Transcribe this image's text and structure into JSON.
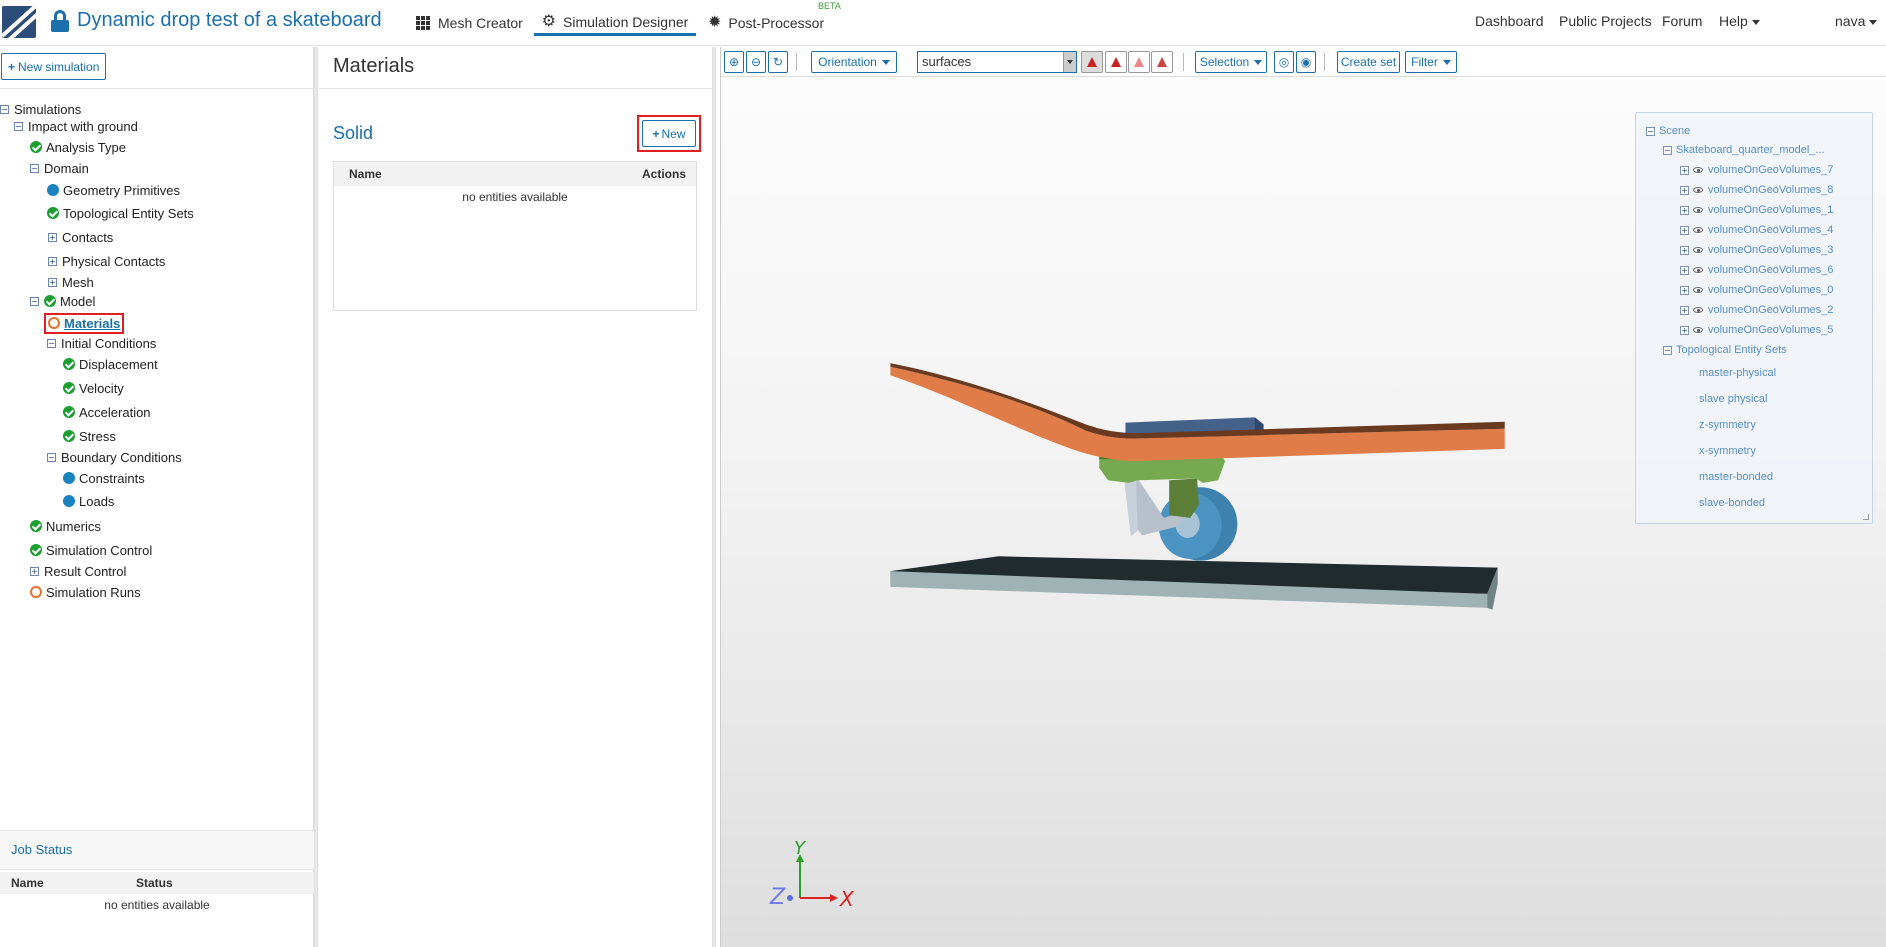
{
  "nav": {
    "title": "Dynamic drop test of a skateboard",
    "tabs": [
      {
        "label": "Mesh Creator",
        "icon": "grid-icon"
      },
      {
        "label": "Simulation Designer",
        "icon": "gear-icon",
        "active": true
      },
      {
        "label": "Post-Processor",
        "icon": "cog-icon"
      }
    ],
    "beta": "BETA",
    "right": {
      "dashboard": "Dashboard",
      "public_projects": "Public Projects",
      "forum": "Forum",
      "help": "Help",
      "user": "nava"
    }
  },
  "sidebar": {
    "new_simulation": "New simulation",
    "tree": {
      "root": "Simulations",
      "simulation": "Impact with ground",
      "analysis_type": "Analysis Type",
      "domain": "Domain",
      "geometry_primitives": "Geometry Primitives",
      "topological_entity_sets": "Topological Entity Sets",
      "contacts": "Contacts",
      "physical_contacts": "Physical Contacts",
      "mesh": "Mesh",
      "model": "Model",
      "materials": "Materials",
      "initial_conditions": "Initial Conditions",
      "displacement": "Displacement",
      "velocity": "Velocity",
      "acceleration": "Acceleration",
      "stress": "Stress",
      "boundary_conditions": "Boundary Conditions",
      "constraints": "Constraints",
      "loads": "Loads",
      "numerics": "Numerics",
      "simulation_control": "Simulation Control",
      "result_control": "Result Control",
      "simulation_runs": "Simulation Runs"
    },
    "job_status": {
      "title": "Job Status",
      "col_name": "Name",
      "col_status": "Status",
      "empty": "no entities available"
    }
  },
  "materials": {
    "title": "Materials",
    "section": "Solid",
    "new_label": "New",
    "col_name": "Name",
    "col_actions": "Actions",
    "empty": "no entities available"
  },
  "viewer": {
    "orientation": "Orientation",
    "render_mode": "surfaces",
    "selection": "Selection",
    "create_set": "Create set",
    "filter": "Filter",
    "scene": {
      "root": "Scene",
      "model": "Skateboard_quarter_model_...",
      "volumes": [
        "volumeOnGeoVolumes_7",
        "volumeOnGeoVolumes_8",
        "volumeOnGeoVolumes_1",
        "volumeOnGeoVolumes_4",
        "volumeOnGeoVolumes_3",
        "volumeOnGeoVolumes_6",
        "volumeOnGeoVolumes_0",
        "volumeOnGeoVolumes_2",
        "volumeOnGeoVolumes_5"
      ],
      "topo_sets": "Topological Entity Sets",
      "sets": [
        "master-physical",
        "slave physical",
        "z-symmetry",
        "x-symmetry",
        "master-bonded",
        "slave-bonded"
      ]
    },
    "axes": {
      "y": "Y",
      "z": "Z",
      "x": "X"
    }
  },
  "colors": {
    "accent": "#1b6faa",
    "success": "#1c9e33",
    "warning": "#e8722c",
    "highlight": "#e02020"
  }
}
